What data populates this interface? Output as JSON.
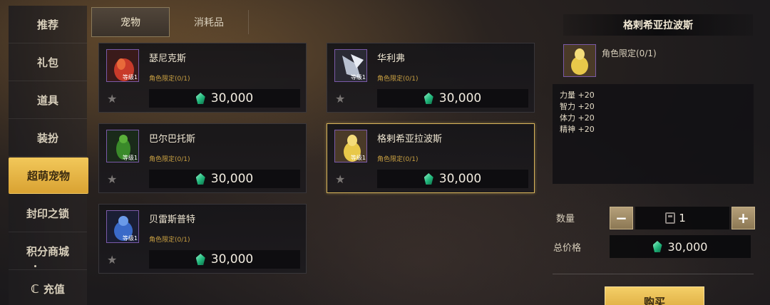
{
  "sidebar": {
    "items": [
      {
        "label": "推荐"
      },
      {
        "label": "礼包"
      },
      {
        "label": "道具"
      },
      {
        "label": "装扮"
      },
      {
        "label": "超萌宠物"
      },
      {
        "label": "封印之锁"
      },
      {
        "label": "积分商城"
      },
      {
        "label": "充值",
        "icon": "c-coin-icon"
      }
    ],
    "active_index": 4
  },
  "tabs": [
    {
      "label": "宠物"
    },
    {
      "label": "消耗品"
    }
  ],
  "active_tab": 0,
  "items": [
    {
      "name": "瑟尼克斯",
      "restriction": "角色限定(0/1)",
      "price": "30,000",
      "level": "等级1",
      "color": "#c83a2a"
    },
    {
      "name": "华利弗",
      "restriction": "角色限定(0/1)",
      "price": "30,000",
      "level": "等级1",
      "color": "#9aa0b0"
    },
    {
      "name": "巴尔巴托斯",
      "restriction": "角色限定(0/1)",
      "price": "30,000",
      "level": "等级1",
      "color": "#3a8a2a"
    },
    {
      "name": "格剌希亚拉波斯",
      "restriction": "角色限定(0/1)",
      "price": "30,000",
      "level": "等级1",
      "color": "#e8c84a"
    },
    {
      "name": "贝雷斯普特",
      "restriction": "角色限定(0/1)",
      "price": "30,000",
      "level": "等级1",
      "color": "#3a6ac8"
    }
  ],
  "selected_item_index": 3,
  "detail": {
    "title": "格剌希亚拉波斯",
    "restriction": "角色限定(0/1)",
    "stats": [
      "力量 +20",
      "智力 +20",
      "体力 +20",
      "精神 +20"
    ],
    "quantity_label": "数量",
    "quantity": "1",
    "total_label": "总价格",
    "total": "30,000",
    "buy_label": "购买"
  },
  "colors": {
    "accent_gold": "#e0b04a",
    "currency_gem": "#2ed18f",
    "frame_purple": "#7a5aa8"
  }
}
